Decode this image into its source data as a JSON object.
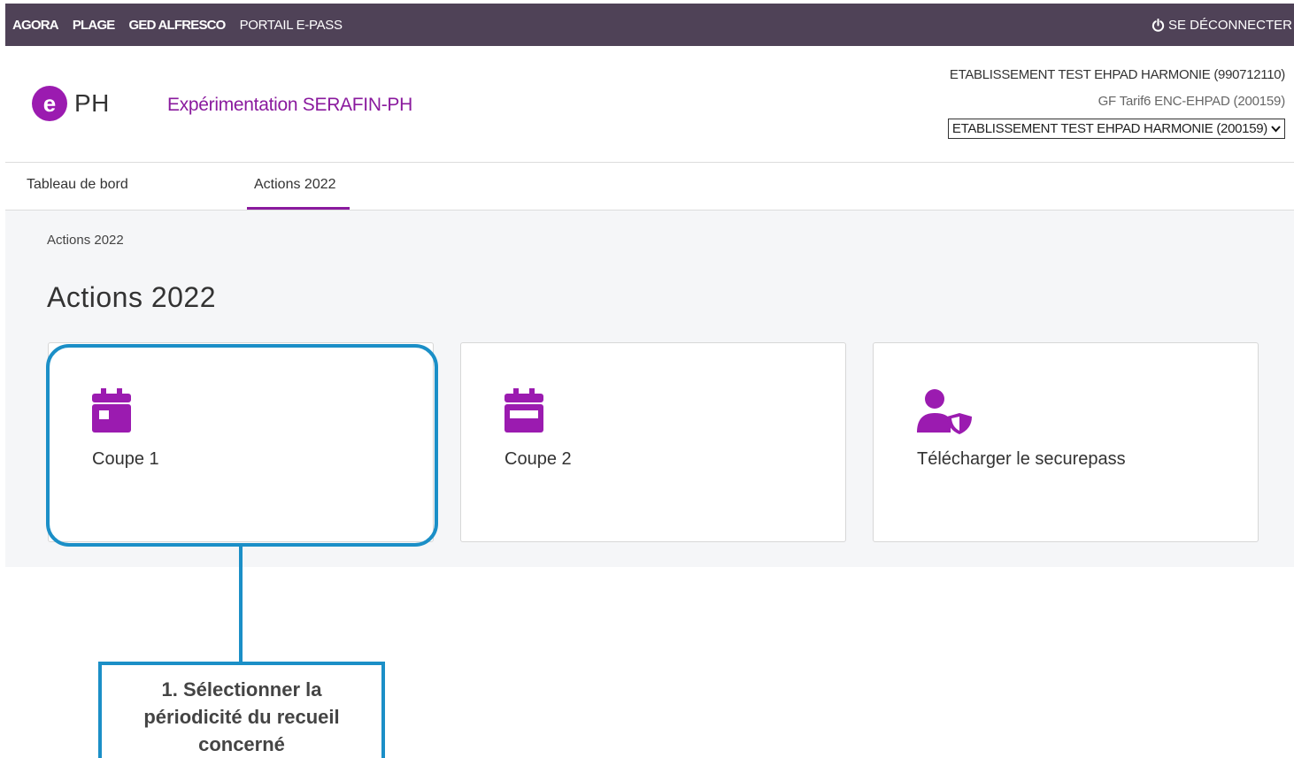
{
  "topbar": {
    "links": [
      "AGORA",
      "PLAGE",
      "GED ALFRESCO",
      "PORTAIL E-PASS"
    ],
    "logout": "SE DÉCONNECTER",
    "logout_icon": "power-icon"
  },
  "header": {
    "logo_letter": "e",
    "logo_text": "PH",
    "app_title": "Expérimentation SERAFIN-PH",
    "establishment_name": "ETABLISSEMENT TEST EHPAD HARMONIE (990712110)",
    "establishment_sub": "GF Tarif6 ENC-EHPAD (200159)",
    "establishment_select_value": "ETABLISSEMENT TEST EHPAD HARMONIE (200159)"
  },
  "tabs": [
    "Tableau de bord",
    "Actions 2022"
  ],
  "active_tab": "Actions 2022",
  "main": {
    "breadcrumb": "Actions 2022",
    "title": "Actions 2022",
    "cards": [
      {
        "label": "Coupe 1",
        "icon": "calendar-icon"
      },
      {
        "label": "Coupe 2",
        "icon": "calendar-range-icon"
      },
      {
        "label": "Télécharger le securepass",
        "icon": "user-shield-icon"
      }
    ]
  },
  "annotation": {
    "line1": "1. Sélectionner la",
    "line2": "périodicité du recueil",
    "line3": "concerné"
  },
  "colors": {
    "topbar": "#4f4257",
    "accent": "#8a1a9e",
    "highlight": "#1b8fc7"
  }
}
